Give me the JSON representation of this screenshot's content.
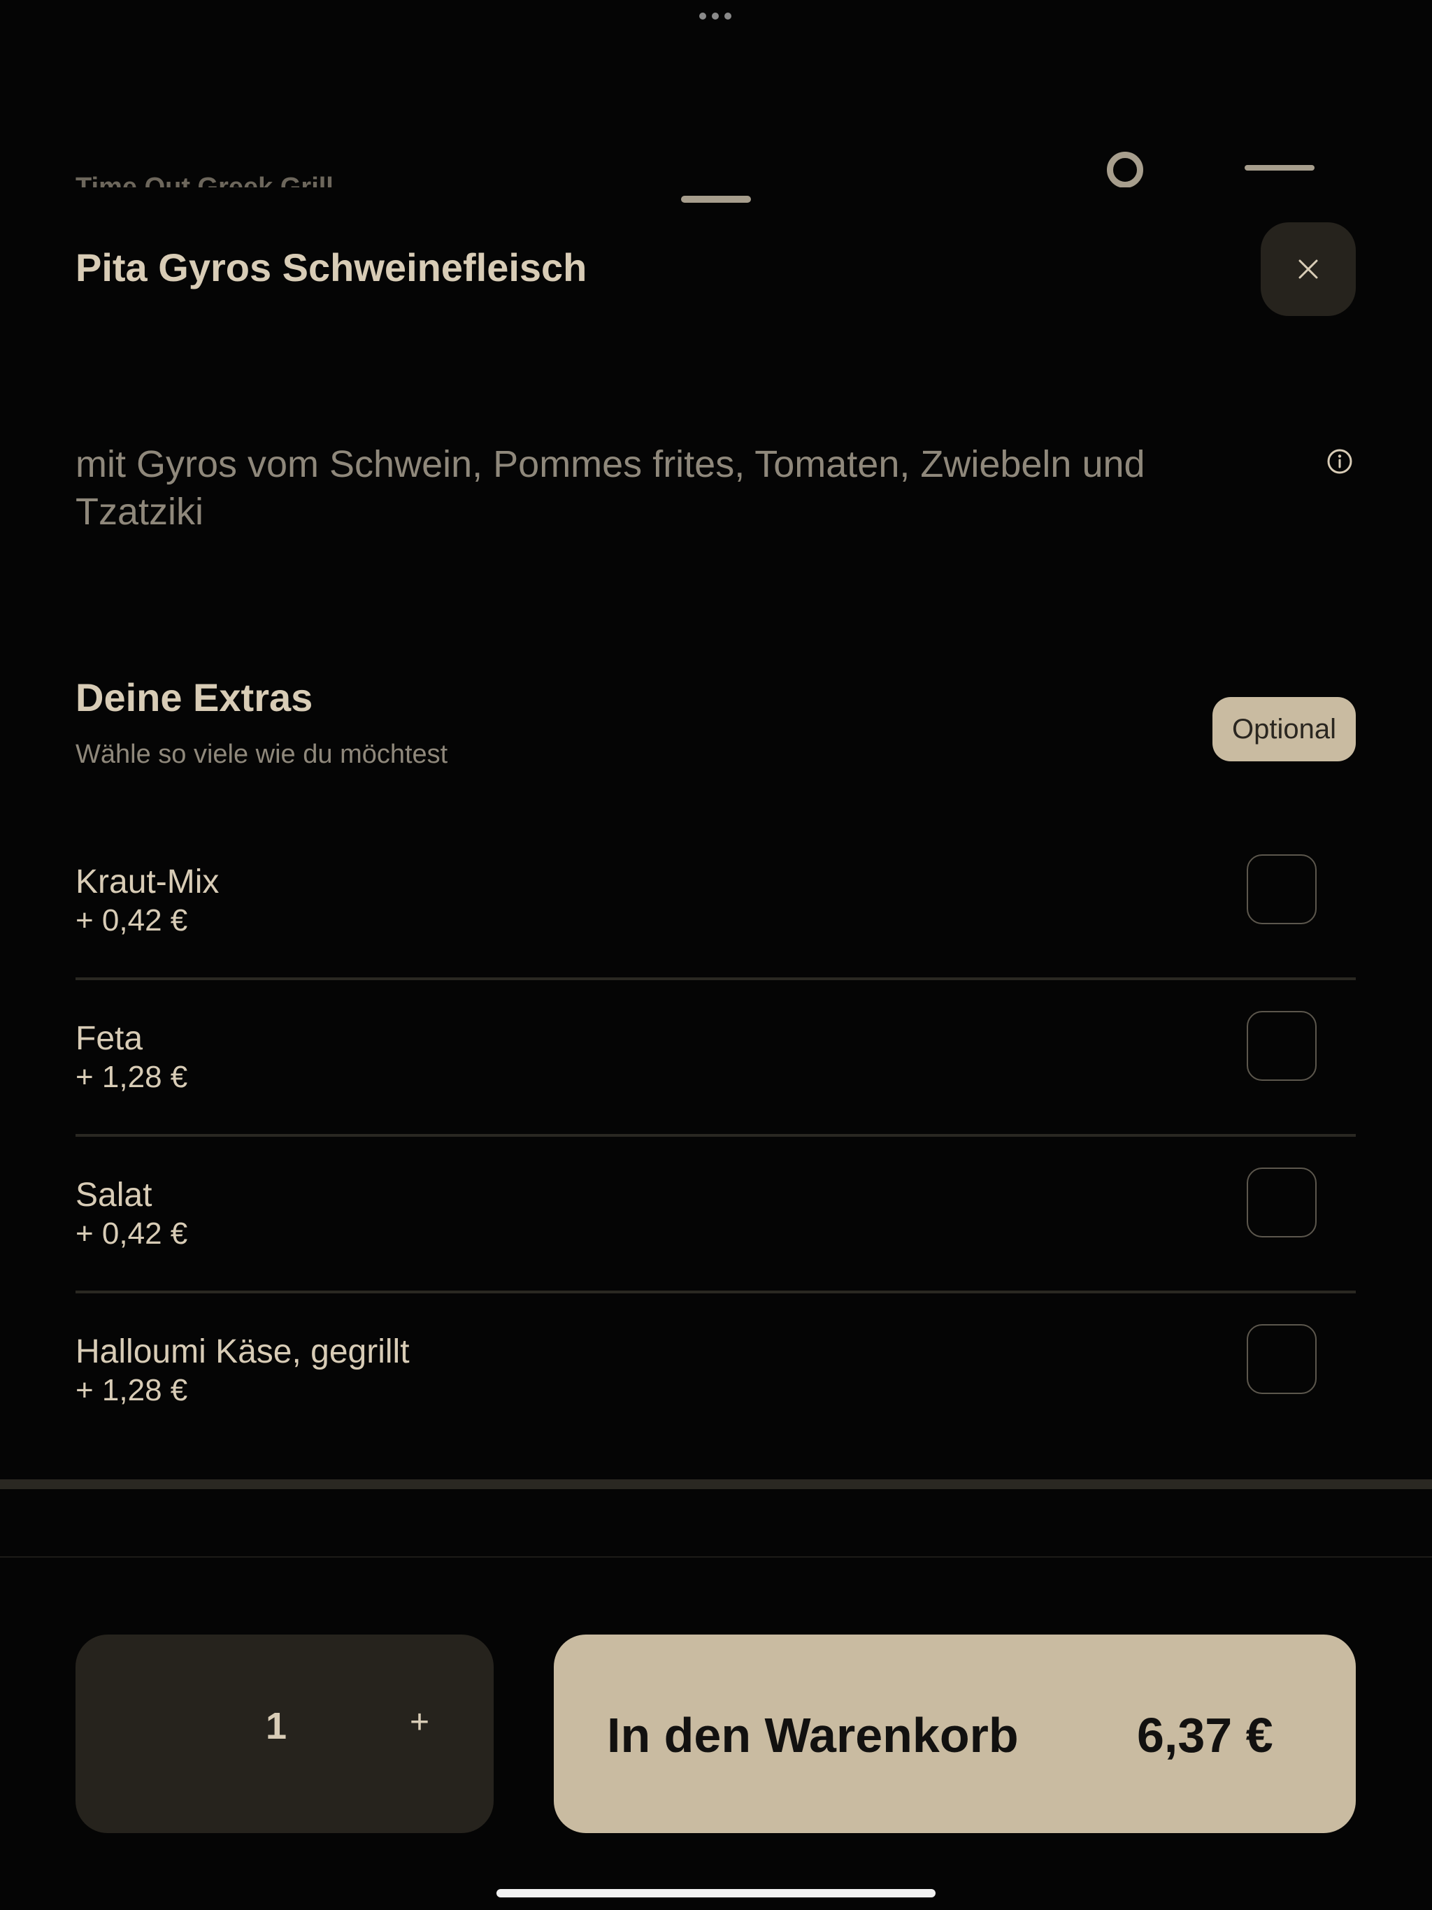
{
  "background": {
    "restaurant_title": "Time Out Greek Grill"
  },
  "sheet": {
    "title": "Pita Gyros Schweinefleisch",
    "description": "mit Gyros vom Schwein, Pommes frites, Tomaten, Zwiebeln und Tzatziki"
  },
  "extras": {
    "title": "Deine Extras",
    "subtitle": "Wähle so viele wie du möchtest",
    "badge": "Optional",
    "options": [
      {
        "name": "Kraut-Mix",
        "price": "+ 0,42 €"
      },
      {
        "name": "Feta",
        "price": "+ 1,28 €"
      },
      {
        "name": "Salat",
        "price": "+ 0,42 €"
      },
      {
        "name": "Halloumi Käse, gegrillt",
        "price": "+ 1,28 €"
      }
    ]
  },
  "footer": {
    "quantity": "1",
    "plus_symbol": "+",
    "cart_label": "In den Warenkorb",
    "cart_price": "6,37 €"
  },
  "colors": {
    "background": "#050505",
    "accent": "#c9bba1",
    "surface": "#26231d",
    "text_primary": "#d8ccb6",
    "text_secondary": "#8f887b"
  }
}
